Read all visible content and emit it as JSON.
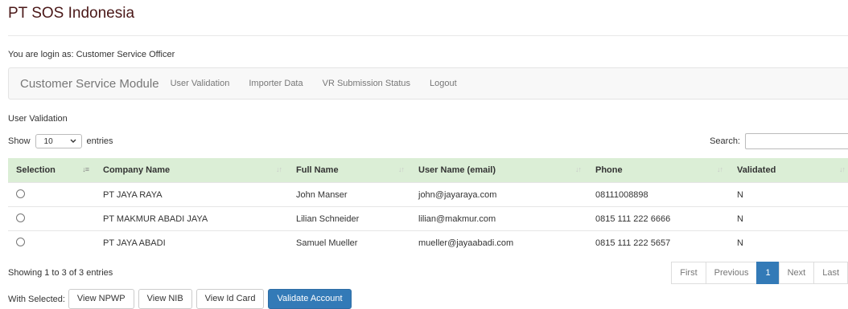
{
  "app_title": "PT SOS Indonesia",
  "login_info": "You are login as: Customer Service Officer",
  "navbar": {
    "brand": "Customer Service Module",
    "links": [
      "User Validation",
      "Importer Data",
      "VR Submission Status",
      "Logout"
    ]
  },
  "section_label": "User Validation",
  "length_control": {
    "show_label": "Show",
    "value": "10",
    "entries_label": "entries"
  },
  "search": {
    "label": "Search:",
    "value": ""
  },
  "table": {
    "columns": [
      "Selection",
      "Company Name",
      "Full Name",
      "User Name (email)",
      "Phone",
      "Validated"
    ],
    "rows": [
      {
        "company": "PT JAYA RAYA",
        "full_name": "John Manser",
        "email": "john@jayaraya.com",
        "phone": "08111008898",
        "validated": "N"
      },
      {
        "company": "PT MAKMUR ABADI JAYA",
        "full_name": "Lilian Schneider",
        "email": "lilian@makmur.com",
        "phone": "0815 111 222 6666",
        "validated": "N"
      },
      {
        "company": "PT JAYA ABADI",
        "full_name": "Samuel Mueller",
        "email": "mueller@jayaabadi.com",
        "phone": "0815 111 222 5657",
        "validated": "N"
      }
    ]
  },
  "info_text": "Showing 1 to 3 of 3 entries",
  "pagination": {
    "first": "First",
    "previous": "Previous",
    "current": "1",
    "next": "Next",
    "last": "Last"
  },
  "with_selected": {
    "label": "With Selected:",
    "buttons": [
      "View NPWP",
      "View NIB",
      "View Id Card",
      "Validate Account"
    ]
  },
  "colors": {
    "header_bg": "#dbeed6",
    "primary": "#337ab7",
    "title": "#4a1818"
  }
}
